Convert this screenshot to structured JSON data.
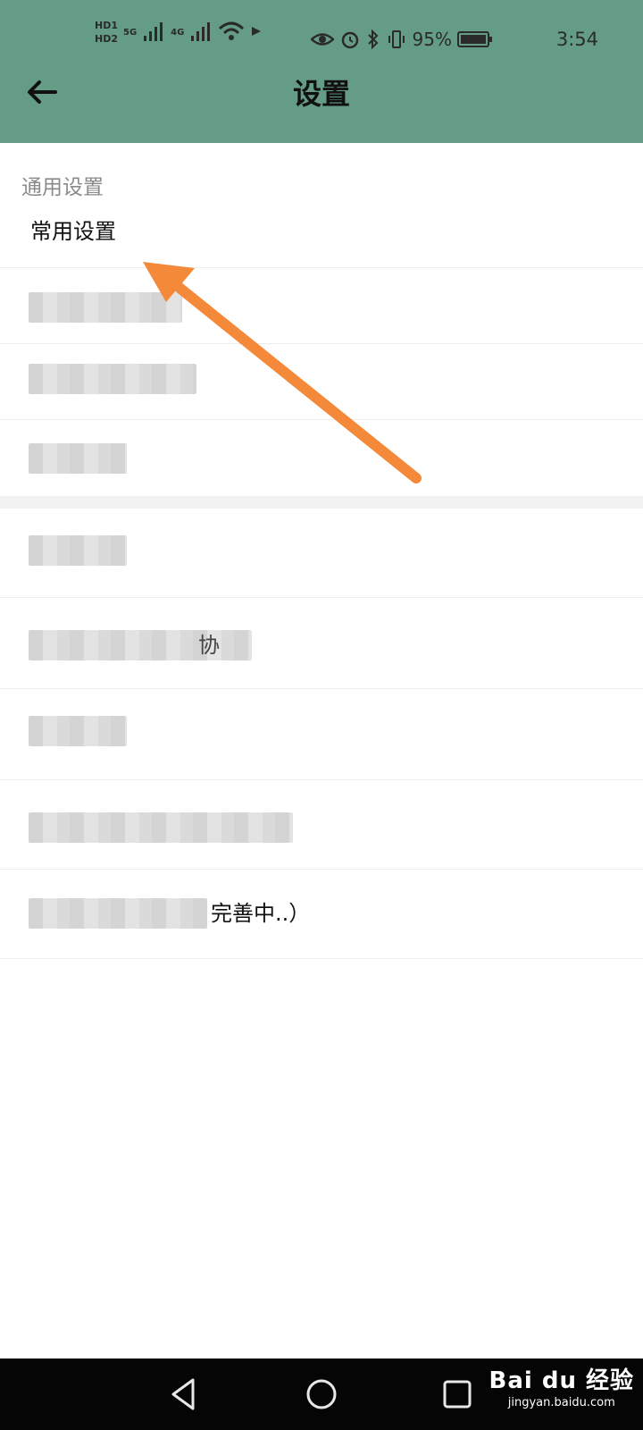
{
  "status_bar": {
    "hd1": "HD1",
    "hd2": "HD2",
    "net_5g": "5G",
    "net_4g": "4G",
    "battery": "95%",
    "time": "3:54"
  },
  "header": {
    "title": "设置",
    "back_icon": "arrow-left-icon",
    "background": "#649c86"
  },
  "section": {
    "title": "通用设置"
  },
  "items": [
    {
      "label": "常用设置"
    },
    {
      "label": ""
    },
    {
      "label": ""
    },
    {
      "label": ""
    },
    {
      "label": ""
    },
    {
      "label": ""
    },
    {
      "label": ""
    },
    {
      "label": ""
    }
  ],
  "partial_texts": {
    "row5": "协",
    "row8": "完善中..）"
  },
  "annotation": {
    "color": "#f5893a"
  },
  "watermark": {
    "main": "Bai du 经验",
    "sub": "jingyan.baidu.com"
  }
}
